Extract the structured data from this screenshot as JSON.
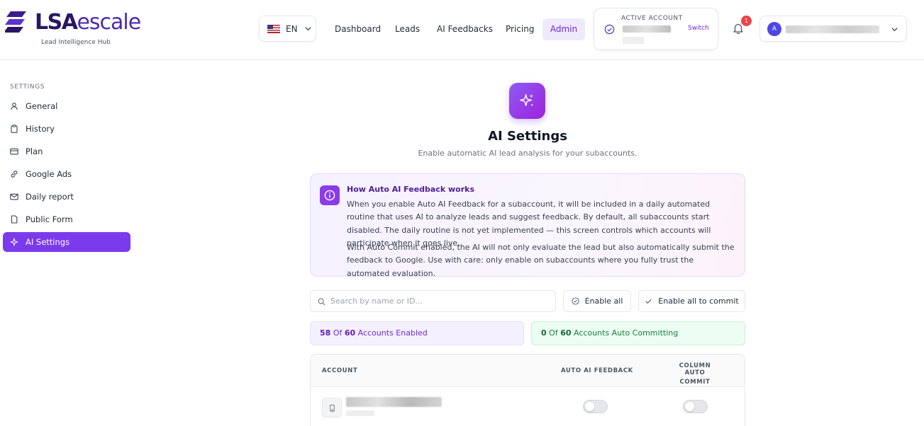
{
  "brand": {
    "logo_main": "LSA",
    "logo_accent": "escale",
    "subtitle": "Lead Intelligence Hub",
    "colors": {
      "primary": "#7c3aed",
      "dark": "#2a1763"
    }
  },
  "header": {
    "language": {
      "flag": "us-flag-icon",
      "code": "EN"
    },
    "nav": [
      "Dashboard",
      "Leads",
      "AI Feedbacks",
      "Pricing",
      "Admin"
    ],
    "active_nav": "Admin",
    "account": {
      "label": "ACTIVE ACCOUNT",
      "switch_label": "Switch"
    },
    "notifications": {
      "count": "1"
    },
    "user": {
      "avatar_initial": "A"
    }
  },
  "sidebar": {
    "heading": "SETTINGS",
    "items": [
      {
        "label": "General",
        "icon": "user-icon"
      },
      {
        "label": "History",
        "icon": "clipboard-icon"
      },
      {
        "label": "Plan",
        "icon": "credit-card-icon"
      },
      {
        "label": "Google Ads",
        "icon": "link-icon"
      },
      {
        "label": "Daily report",
        "icon": "mail-icon"
      },
      {
        "label": "Public Form",
        "icon": "file-icon"
      },
      {
        "label": "AI Settings",
        "icon": "sparkles-icon"
      }
    ],
    "active": "AI Settings"
  },
  "main": {
    "title": "AI Settings",
    "subtitle": "Enable automatic AI lead analysis for your subaccounts.",
    "info": {
      "title": "How Auto AI Feedback works",
      "p1": "When you enable Auto AI Feedback for a subaccount, it will be included in a daily automated routine that uses AI to analyze leads and suggest feedback. By default, all subaccounts start disabled. The daily routine is not yet implemented — this screen controls which accounts will participate when it goes live.",
      "p2": "With Auto Commit enabled, the AI will not only evaluate the lead but also automatically submit the feedback to Google. Use with care: only enable on subaccounts where you fully trust the automated evaluation."
    },
    "search": {
      "placeholder": "Search by name or ID...",
      "value": ""
    },
    "buttons": {
      "enable_all": "Enable all",
      "enable_all_commit": "Enable all to commit"
    },
    "stats": {
      "enabled": {
        "count": "58",
        "of": "Of",
        "total": "60",
        "label": "Accounts Enabled"
      },
      "committing": {
        "count": "0",
        "of": "Of",
        "total": "60",
        "label": "Accounts Auto Committing"
      }
    },
    "table": {
      "columns": {
        "account": "ACCOUNT",
        "auto_ai": "AUTO AI FEEDBACK",
        "auto_commit_1": "COLUMN AUTO",
        "auto_commit_2": "COMMIT"
      },
      "rows": [
        {
          "auto_ai_feedback": false,
          "auto_commit": false
        }
      ]
    }
  }
}
